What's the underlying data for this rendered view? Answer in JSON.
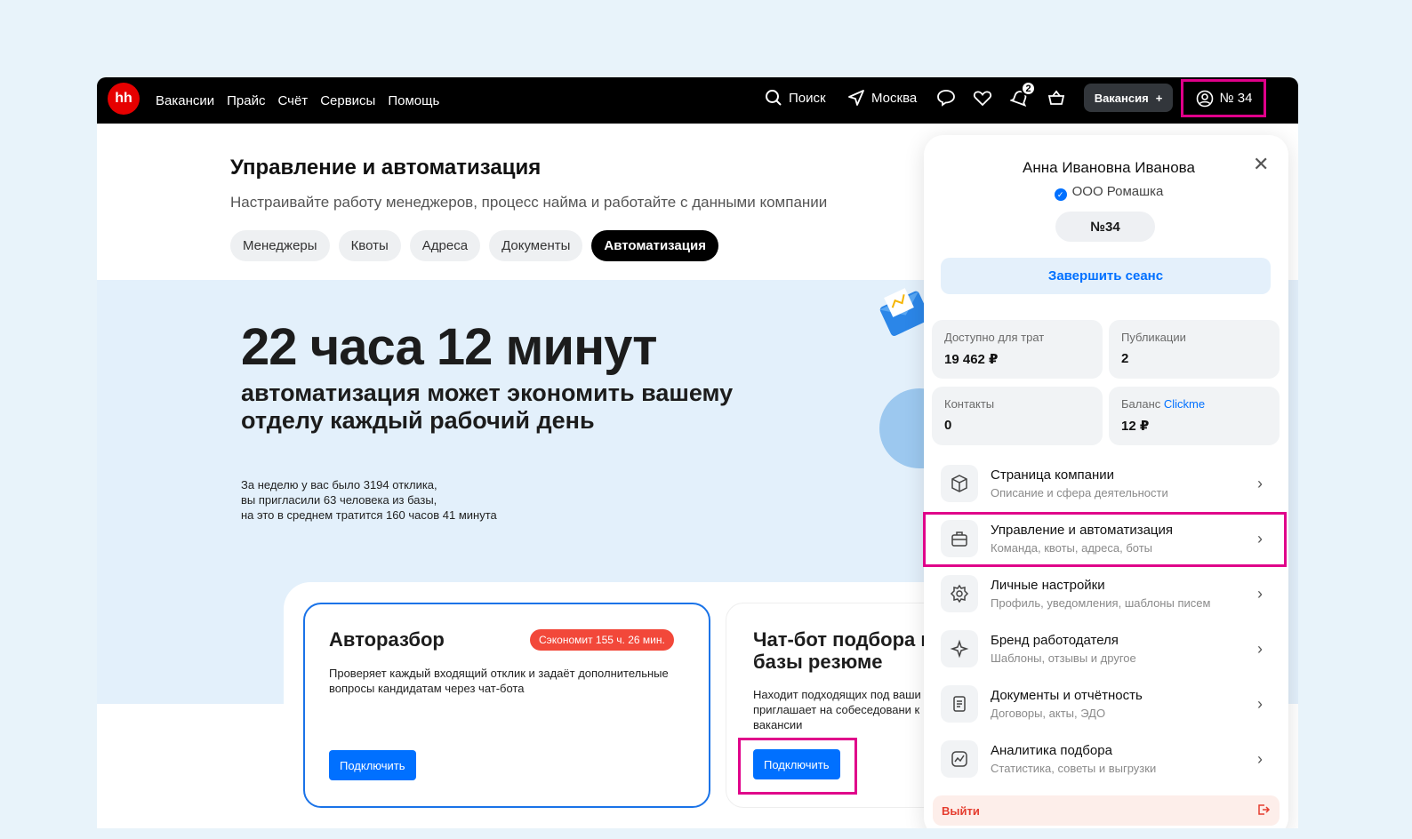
{
  "nav": {
    "logo": "hh",
    "links": [
      "Вакансии",
      "Прайс",
      "Счёт",
      "Сервисы",
      "Помощь"
    ],
    "search_label": "Поиск",
    "city_label": "Москва",
    "notifications_count": "2",
    "vacancy_button": "Вакансия",
    "vacancy_plus": "+",
    "account_label": "№ 34"
  },
  "header": {
    "title": "Управление и автоматизация",
    "subtitle": "Настраивайте работу менеджеров, процесс найма и работайте с данными компании",
    "tabs": [
      "Менеджеры",
      "Квоты",
      "Адреса",
      "Документы",
      "Автоматизация"
    ],
    "active_tab": "Автоматизация"
  },
  "hero": {
    "big": "22 часа 12 минут",
    "mid": "автоматизация может экономить вашему отделу каждый рабочий день",
    "small_lines": [
      "За неделю у вас было 3194 отклика,",
      "вы пригласили 63 человека из базы,",
      "на это в среднем тратится 160 часов 41 минута"
    ]
  },
  "cards": [
    {
      "title": "Авторазбор",
      "badge": "Сэкономит 155 ч. 26 мин.",
      "desc": "Проверяет каждый входящий отклик и задаёт дополнительные вопросы кандидатам через чат-бота",
      "button": "Подключить"
    },
    {
      "title": "Чат-бот подбора из базы резюме",
      "desc": "Находит подходящих под ваши и приглашает на собеседовани к вакансии",
      "button": "Подключить"
    }
  ],
  "panel": {
    "name": "Анна Ивановна Иванова",
    "company": "ООО Ромашка",
    "number": "№34",
    "end_session": "Завершить сеанс",
    "close": "✕",
    "stats": [
      {
        "label": "Доступно для трат",
        "value": "19 462 ₽"
      },
      {
        "label": "Публикации",
        "value": "2"
      },
      {
        "label": "Контакты",
        "value": "0"
      },
      {
        "label_prefix": "Баланс ",
        "label_link": "Clickme",
        "value": "12 ₽"
      }
    ],
    "menu": [
      {
        "title": "Страница компании",
        "sub": "Описание и сфера деятельности",
        "icon": "box-icon"
      },
      {
        "title": "Управление и автоматизация",
        "sub": "Команда, квоты, адреса, боты",
        "icon": "briefcase-icon"
      },
      {
        "title": "Личные настройки",
        "sub": "Профиль, уведомления, шаблоны писем",
        "icon": "gear-icon"
      },
      {
        "title": "Бренд работодателя",
        "sub": "Шаблоны, отзывы и другое",
        "icon": "sparkle-icon"
      },
      {
        "title": "Документы и отчётность",
        "sub": "Договоры, акты, ЭДО",
        "icon": "document-icon"
      },
      {
        "title": "Аналитика подбора",
        "sub": "Статистика, советы и выгрузки",
        "icon": "chart-icon"
      }
    ],
    "logout": "Выйти"
  },
  "colors": {
    "accent": "#0070ff",
    "brand": "#e60000",
    "highlight": "#e0008a",
    "badge": "#f2483a"
  }
}
